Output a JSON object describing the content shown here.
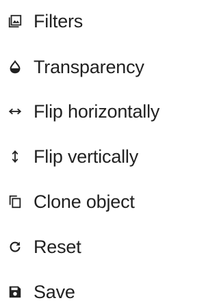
{
  "menu": {
    "items": [
      {
        "label": "Filters",
        "icon": "filters-icon"
      },
      {
        "label": "Transparency",
        "icon": "transparency-droplet-icon"
      },
      {
        "label": "Flip horizontally",
        "icon": "flip-horizontal-arrows-icon"
      },
      {
        "label": "Flip vertically",
        "icon": "flip-vertical-arrows-icon"
      },
      {
        "label": "Clone object",
        "icon": "clone-icon"
      },
      {
        "label": "Reset",
        "icon": "reset-icon"
      },
      {
        "label": "Save",
        "icon": "save-icon"
      }
    ]
  }
}
